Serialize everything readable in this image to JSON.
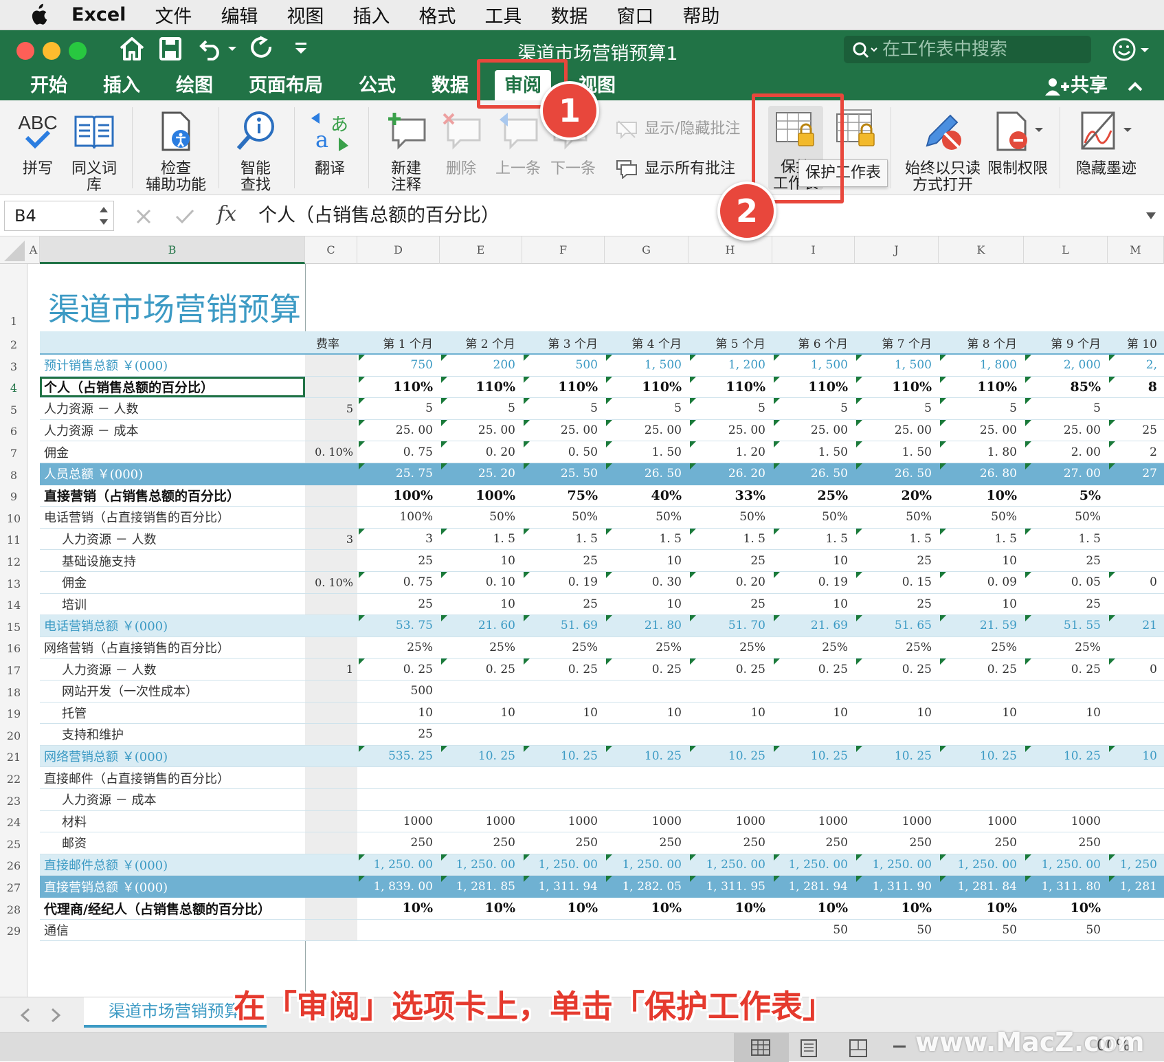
{
  "menubar": {
    "app": "Excel",
    "items": [
      "文件",
      "编辑",
      "视图",
      "插入",
      "格式",
      "工具",
      "数据",
      "窗口",
      "帮助"
    ]
  },
  "window": {
    "title": "渠道市场营销预算1",
    "search_placeholder": "在工作表中搜索"
  },
  "tabs": [
    {
      "label": "开始"
    },
    {
      "label": "插入"
    },
    {
      "label": "绘图"
    },
    {
      "label": "页面布局"
    },
    {
      "label": "公式"
    },
    {
      "label": "数据"
    },
    {
      "label": "审阅",
      "active": true
    },
    {
      "label": "视图"
    }
  ],
  "share_label": "共享",
  "ribbon": {
    "spelling": "拼写",
    "thesaurus_1": "同义词",
    "thesaurus_2": "库",
    "accessibility_1": "检查",
    "accessibility_2": "辅助功能",
    "smart_lookup_1": "智能",
    "smart_lookup_2": "查找",
    "translate": "翻译",
    "new_comment_1": "新建",
    "new_comment_2": "注释",
    "delete": "删除",
    "previous": "上一条",
    "next": "下一条",
    "show_hide_comments": "显示/隐藏批注",
    "show_all_comments": "显示所有批注",
    "protect_sheet_1": "保护",
    "protect_sheet_2": "工作表",
    "tooltip": "保护工作表",
    "read_only_1": "始终以只读",
    "read_only_2": "方式打开",
    "restrict": "限制权限",
    "hide_ink": "隐藏墨迹"
  },
  "formula_bar": {
    "cell_ref": "B4",
    "fx": "fx",
    "content": "个人（占销售总额的百分比）"
  },
  "columns": [
    "A",
    "B",
    "C",
    "D",
    "E",
    "F",
    "G",
    "H",
    "I",
    "J",
    "K",
    "L",
    "M"
  ],
  "sheet": {
    "title": "渠道市场营销预算",
    "header_row": [
      "费率",
      "第 1 个月",
      "第 2 个月",
      "第 3 个月",
      "第 4 个月",
      "第 5 个月",
      "第 6 个月",
      "第 7 个月",
      "第 8 个月",
      "第 9 个月",
      "第 10"
    ],
    "rows": [
      {
        "n": "3",
        "label": "预计销售总额 ￥(000)",
        "rate": "",
        "vals": [
          "750",
          "200",
          "500",
          "1, 500",
          "1, 200",
          "1, 500",
          "1, 500",
          "1, 800",
          "2, 000",
          "2,"
        ],
        "style": "blue"
      },
      {
        "n": "4",
        "label": "个人（占销售总额的百分比）",
        "rate": "",
        "vals": [
          "110%",
          "110%",
          "110%",
          "110%",
          "110%",
          "110%",
          "110%",
          "110%",
          "85%",
          "8"
        ],
        "style": "bold"
      },
      {
        "n": "5",
        "label": "人力资源 － 人数",
        "rate": "5",
        "vals": [
          "5",
          "5",
          "5",
          "5",
          "5",
          "5",
          "5",
          "5",
          "5",
          ""
        ],
        "style": "normal"
      },
      {
        "n": "6",
        "label": "人力资源 － 成本",
        "rate": "",
        "vals": [
          "25. 00",
          "25. 00",
          "25. 00",
          "25. 00",
          "25. 00",
          "25. 00",
          "25. 00",
          "25. 00",
          "25. 00",
          "25"
        ],
        "style": "normal"
      },
      {
        "n": "7",
        "label": "佣金",
        "rate": "0. 10%",
        "vals": [
          "0. 75",
          "0. 20",
          "0. 50",
          "1. 50",
          "1. 20",
          "1. 50",
          "1. 50",
          "1. 80",
          "2. 00",
          "2"
        ],
        "style": "normal"
      },
      {
        "n": "8",
        "label": "人员总额 ￥(000)",
        "rate": "",
        "vals": [
          "25. 75",
          "25. 20",
          "25. 50",
          "26. 50",
          "26. 20",
          "26. 50",
          "26. 50",
          "26. 80",
          "27. 00",
          "27"
        ],
        "style": "darkband"
      },
      {
        "n": "9",
        "label": "直接营销（占销售总额的百分比）",
        "rate": "",
        "vals": [
          "100%",
          "100%",
          "75%",
          "40%",
          "33%",
          "25%",
          "20%",
          "10%",
          "5%",
          ""
        ],
        "style": "bold"
      },
      {
        "n": "10",
        "label": "电话营销（占直接销售的百分比）",
        "rate": "",
        "vals": [
          "100%",
          "50%",
          "50%",
          "50%",
          "50%",
          "50%",
          "50%",
          "50%",
          "50%",
          ""
        ],
        "style": "normal"
      },
      {
        "n": "11",
        "label": "人力资源 － 人数",
        "rate": "3",
        "vals": [
          "3",
          "1. 5",
          "1. 5",
          "1. 5",
          "1. 5",
          "1. 5",
          "1. 5",
          "1. 5",
          "1. 5",
          ""
        ],
        "style": "indent"
      },
      {
        "n": "12",
        "label": "基础设施支持",
        "rate": "",
        "vals": [
          "25",
          "10",
          "25",
          "10",
          "25",
          "10",
          "25",
          "10",
          "25",
          ""
        ],
        "style": "indent"
      },
      {
        "n": "13",
        "label": "佣金",
        "rate": "0. 10%",
        "vals": [
          "0. 75",
          "0. 10",
          "0. 19",
          "0. 30",
          "0. 20",
          "0. 19",
          "0. 15",
          "0. 09",
          "0. 05",
          "0"
        ],
        "style": "indent"
      },
      {
        "n": "14",
        "label": "培训",
        "rate": "",
        "vals": [
          "25",
          "10",
          "25",
          "10",
          "25",
          "10",
          "25",
          "10",
          "25",
          ""
        ],
        "style": "indent"
      },
      {
        "n": "15",
        "label": "电话营销总额 ￥(000)",
        "rate": "",
        "vals": [
          "53. 75",
          "21. 60",
          "51. 69",
          "21. 80",
          "51. 70",
          "21. 69",
          "51. 65",
          "21. 59",
          "51. 55",
          "21"
        ],
        "style": "lightband"
      },
      {
        "n": "16",
        "label": "网络营销（占直接销售的百分比）",
        "rate": "",
        "vals": [
          "25%",
          "25%",
          "25%",
          "25%",
          "25%",
          "25%",
          "25%",
          "25%",
          "25%",
          ""
        ],
        "style": "normal"
      },
      {
        "n": "17",
        "label": "人力资源 － 人数",
        "rate": "1",
        "vals": [
          "0. 25",
          "0. 25",
          "0. 25",
          "0. 25",
          "0. 25",
          "0. 25",
          "0. 25",
          "0. 25",
          "0. 25",
          "0"
        ],
        "style": "indent"
      },
      {
        "n": "18",
        "label": "网站开发（一次性成本）",
        "rate": "",
        "vals": [
          "500",
          "",
          "",
          "",
          "",
          "",
          "",
          "",
          "",
          ""
        ],
        "style": "indent"
      },
      {
        "n": "19",
        "label": "托管",
        "rate": "",
        "vals": [
          "10",
          "10",
          "10",
          "10",
          "10",
          "10",
          "10",
          "10",
          "10",
          ""
        ],
        "style": "indent"
      },
      {
        "n": "20",
        "label": "支持和维护",
        "rate": "",
        "vals": [
          "25",
          "",
          "",
          "",
          "",
          "",
          "",
          "",
          "",
          ""
        ],
        "style": "indent"
      },
      {
        "n": "21",
        "label": "网络营销总额 ￥(000)",
        "rate": "",
        "vals": [
          "535. 25",
          "10. 25",
          "10. 25",
          "10. 25",
          "10. 25",
          "10. 25",
          "10. 25",
          "10. 25",
          "10. 25",
          "10"
        ],
        "style": "lightband"
      },
      {
        "n": "22",
        "label": "直接邮件（占直接销售的百分比）",
        "rate": "",
        "vals": [
          "",
          "",
          "",
          "",
          "",
          "",
          "",
          "",
          "",
          ""
        ],
        "style": "normal"
      },
      {
        "n": "23",
        "label": "人力资源 － 成本",
        "rate": "",
        "vals": [
          "",
          "",
          "",
          "",
          "",
          "",
          "",
          "",
          "",
          ""
        ],
        "style": "indent"
      },
      {
        "n": "24",
        "label": "材料",
        "rate": "",
        "vals": [
          "1000",
          "1000",
          "1000",
          "1000",
          "1000",
          "1000",
          "1000",
          "1000",
          "1000",
          ""
        ],
        "style": "indent"
      },
      {
        "n": "25",
        "label": "邮资",
        "rate": "",
        "vals": [
          "250",
          "250",
          "250",
          "250",
          "250",
          "250",
          "250",
          "250",
          "250",
          ""
        ],
        "style": "indent"
      },
      {
        "n": "26",
        "label": "直接邮件总额 ￥(000)",
        "rate": "",
        "vals": [
          "1, 250. 00",
          "1, 250. 00",
          "1, 250. 00",
          "1, 250. 00",
          "1, 250. 00",
          "1, 250. 00",
          "1, 250. 00",
          "1, 250. 00",
          "1, 250. 00",
          "1, 250"
        ],
        "style": "lightband"
      },
      {
        "n": "27",
        "label": "直接营销总额 ￥(000)",
        "rate": "",
        "vals": [
          "1, 839. 00",
          "1, 281. 85",
          "1, 311. 94",
          "1, 282. 05",
          "1, 311. 95",
          "1, 281. 94",
          "1, 311. 90",
          "1, 281. 84",
          "1, 311. 80",
          "1, 281"
        ],
        "style": "darkband"
      },
      {
        "n": "28",
        "label": "代理商/经纪人（占销售总额的百分比）",
        "rate": "",
        "vals": [
          "10%",
          "10%",
          "10%",
          "10%",
          "10%",
          "10%",
          "10%",
          "10%",
          "10%",
          ""
        ],
        "style": "bold"
      },
      {
        "n": "29",
        "label": "通信",
        "rate": "",
        "vals": [
          "",
          "",
          "",
          "",
          "",
          "50",
          "50",
          "50",
          "50",
          ""
        ],
        "style": "normal"
      }
    ]
  },
  "sheet_tab": "渠道市场营销预算",
  "annotations": {
    "badge1": "1",
    "badge2": "2",
    "caption": "在「审阅」选项卡上，单击「保护工作表」"
  },
  "status": {
    "zoom": "00%"
  },
  "watermark": "www.MacZ.com",
  "colors": {
    "excel_green": "#217346",
    "accent_blue": "#3c9ac4",
    "band_dark": "#6fb1d2",
    "band_light": "#d9ecf4",
    "annotation_red": "#e8473c"
  }
}
